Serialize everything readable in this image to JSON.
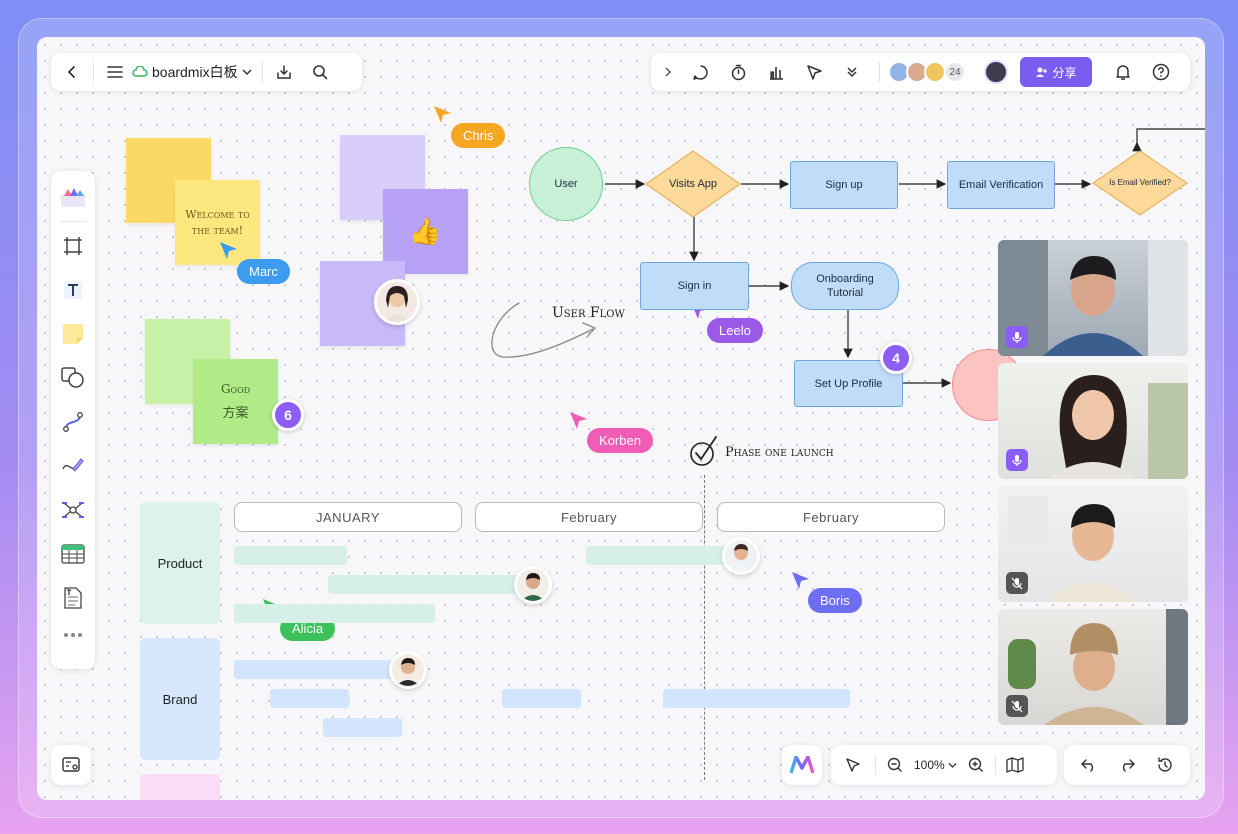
{
  "header": {
    "board_name": "boardmix白板",
    "share_label": "分享",
    "collaborator_count": "24"
  },
  "stickies": {
    "welcome": "Welcome to the team!",
    "good_line1": "Good",
    "good_line2": "方案",
    "thumbs": "👍"
  },
  "cursors": [
    {
      "name": "Chris",
      "color": "#f5a623"
    },
    {
      "name": "Marc",
      "color": "#3d9bf0"
    },
    {
      "name": "Leelo",
      "color": "#9b59e8"
    },
    {
      "name": "Korben",
      "color": "#ef5db7"
    },
    {
      "name": "Alicia",
      "color": "#3dc25b"
    },
    {
      "name": "Boris",
      "color": "#6d6ef2"
    }
  ],
  "badges": {
    "stickies_count": "6",
    "flow_count": "4"
  },
  "user_flow_label": "User Flow",
  "phase_label": "Phase one launch",
  "flow": {
    "user": "User",
    "visits_app": "Visits App",
    "sign_up": "Sign up",
    "email_verification": "Email Verification",
    "is_email_verified": "Is Email Verified?",
    "sign_in": "Sign in",
    "onboarding_tutorial": "Onboarding Tutorial",
    "set_up_profile": "Set Up Profile"
  },
  "timeline": {
    "months": [
      "JANUARY",
      "February",
      "February"
    ],
    "rows": [
      "Product",
      "Brand"
    ]
  },
  "zoom": "100%",
  "colors": {
    "accent": "#7b5cf0",
    "sticky_yellow": "#fcd866",
    "sticky_purple": "#d9cdfa",
    "sticky_green": "#b6ec8f",
    "flow_blue": "#bfdcf8",
    "diamond_orange": "#fdd99b",
    "circle_green": "#c7f0d6"
  }
}
